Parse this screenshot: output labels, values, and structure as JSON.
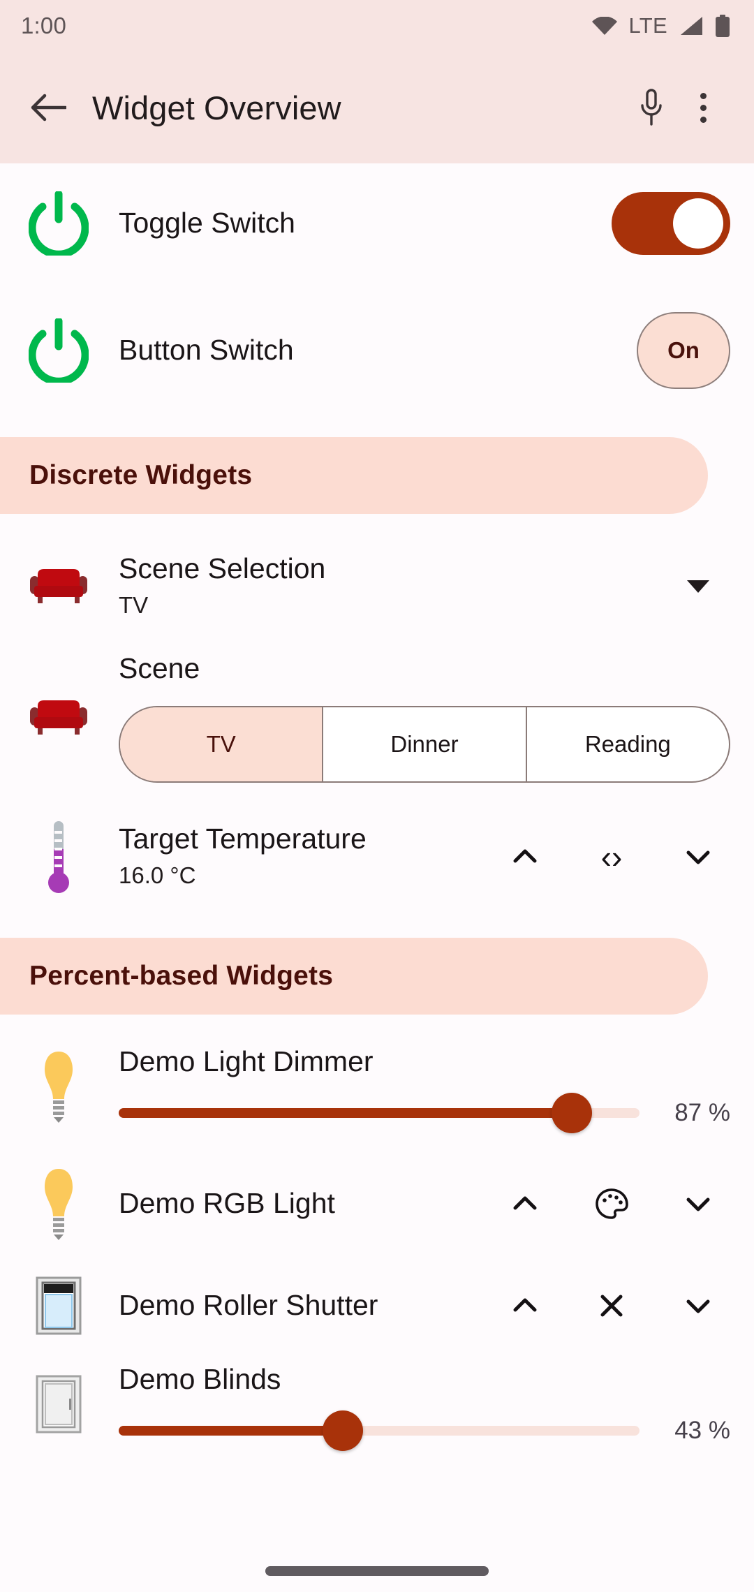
{
  "status_bar": {
    "clock": "1:00",
    "network_label": "LTE",
    "icons": [
      "wifi-icon",
      "signal-icon",
      "battery-icon"
    ]
  },
  "app_bar": {
    "back_icon": "back-arrow-icon",
    "title": "Widget Overview",
    "mic_icon": "microphone-icon",
    "overflow_icon": "overflow-menu-icon"
  },
  "colors": {
    "accent": "#A8320A",
    "app_bar_bg": "#F7E4E2",
    "section_bg": "#FCDCD2",
    "section_text": "#4A100A",
    "selected_bg": "#FBDED3",
    "page_bg": "#FEFBFD",
    "power_icon_green": "#00B84C",
    "couch_red": "#C00A10",
    "bulb_yellow": "#FBC95B",
    "thermo_purple": "#A63BB5"
  },
  "rows": {
    "toggle_switch": {
      "icon": "power-icon",
      "title": "Toggle Switch",
      "control": "toggle",
      "state": "on"
    },
    "button_switch": {
      "icon": "power-icon",
      "title": "Button Switch",
      "control": "button",
      "button_label": "On"
    },
    "scene_selection": {
      "icon": "couch-icon",
      "title": "Scene Selection",
      "subtitle": "TV",
      "control": "dropdown",
      "dropdown_icon": "caret-down-icon"
    },
    "scene": {
      "icon": "couch-icon",
      "title": "Scene",
      "control": "segmented",
      "options": [
        "TV",
        "Dinner",
        "Reading"
      ],
      "selected": "TV"
    },
    "target_temperature": {
      "icon": "thermometer-icon",
      "title": "Target Temperature",
      "subtitle": "16.0 °C",
      "control": "stepper",
      "up_icon": "chevron-up-icon",
      "middle_icon": "left-right-arrows-icon",
      "middle_glyph": "‹›",
      "down_icon": "chevron-down-icon"
    },
    "light_dimmer": {
      "icon": "light-bulb-icon",
      "title": "Demo Light Dimmer",
      "control": "slider",
      "value": 87,
      "value_label": "87 %"
    },
    "rgb_light": {
      "icon": "light-bulb-icon",
      "title": "Demo RGB Light",
      "control": "stepper",
      "up_icon": "chevron-up-icon",
      "middle_icon": "color-palette-icon",
      "down_icon": "chevron-down-icon"
    },
    "roller_shutter": {
      "icon": "roller-shutter-icon",
      "title": "Demo Roller Shutter",
      "control": "stepper",
      "up_icon": "chevron-up-icon",
      "middle_icon": "close-x-icon",
      "middle_glyph": "✕",
      "down_icon": "chevron-down-icon"
    },
    "blinds": {
      "icon": "blinds-icon",
      "title": "Demo Blinds",
      "control": "slider",
      "value": 43,
      "value_label": "43 %"
    }
  },
  "sections": {
    "discrete": "Discrete Widgets",
    "percent": "Percent-based Widgets"
  },
  "navigation_bar": {
    "gesture_pill": "home-gesture-pill"
  }
}
